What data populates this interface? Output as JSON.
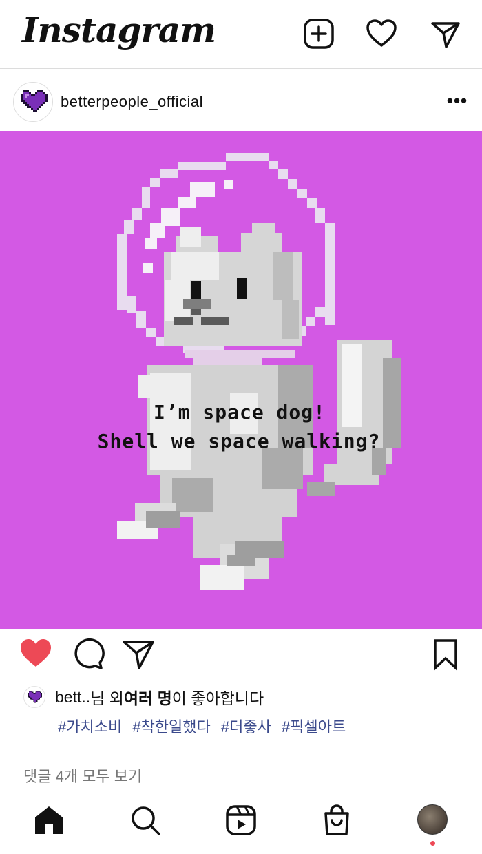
{
  "app": {
    "logo": "Instagram"
  },
  "header_icons": [
    "new-post-icon",
    "heart-icon",
    "direct-message-icon"
  ],
  "post": {
    "username": "betterpeople_official",
    "more_label": "•••",
    "image_caption_line1": "I’m space dog!",
    "image_caption_line2": "Shell we space walking?",
    "liked": true,
    "like_color": "#ed4956",
    "image_background": "#d359e4"
  },
  "likes": {
    "user_short": "bett..",
    "suffix1": "님 외 ",
    "bold": "여러 명",
    "suffix2": "이 좋아합니다"
  },
  "hashtags": [
    "#가치소비",
    "#착한일했다",
    "#더좋사",
    "#픽셀아트"
  ],
  "comments": {
    "view_all_label": "댓글 4개 모두 보기"
  },
  "bottom_nav": [
    "home-icon",
    "search-icon",
    "reels-icon",
    "shop-icon",
    "profile-avatar"
  ]
}
